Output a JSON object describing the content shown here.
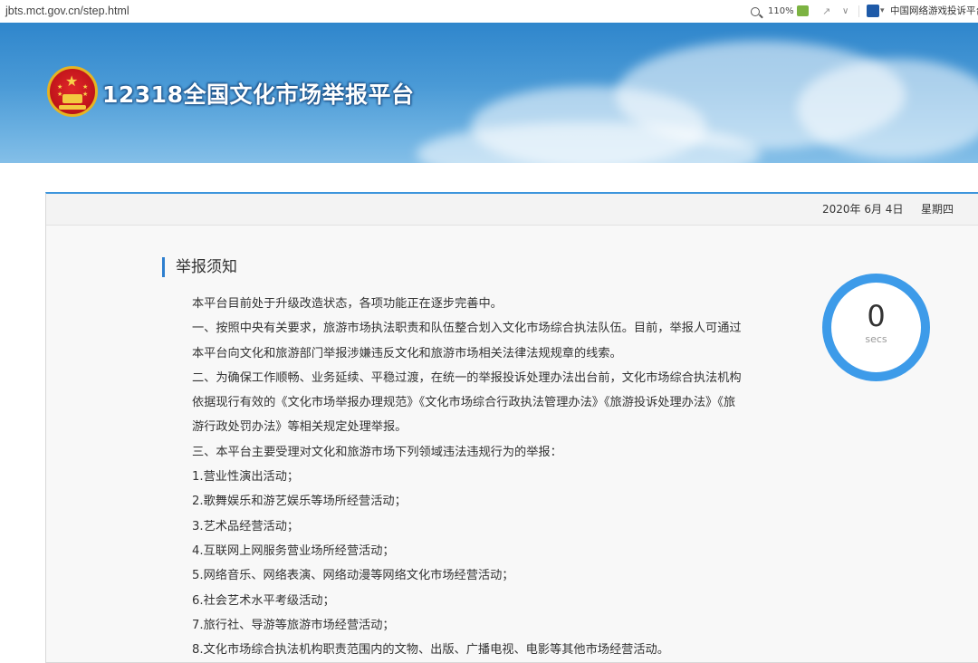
{
  "browser": {
    "url": "jbts.mct.gov.cn/step.html",
    "zoom": "110%",
    "share_glyph": "↗",
    "dropdown_glyph": "∨",
    "favorite_caret": "▾",
    "site_name": "中国网络游戏投诉平台"
  },
  "header": {
    "title": "12318全国文化市场举报平台"
  },
  "datebar": {
    "date": "2020年 6月 4日",
    "weekday": "星期四"
  },
  "notice": {
    "title": "举报须知",
    "paragraphs": [
      "本平台目前处于升级改造状态，各项功能正在逐步完善中。",
      "一、按照中央有关要求，旅游市场执法职责和队伍整合划入文化市场综合执法队伍。目前，举报人可通过本平台向文化和旅游部门举报涉嫌违反文化和旅游市场相关法律法规规章的线索。",
      "二、为确保工作顺畅、业务延续、平稳过渡，在统一的举报投诉处理办法出台前，文化市场综合执法机构依据现行有效的《文化市场举报办理规范》《文化市场综合行政执法管理办法》《旅游投诉处理办法》《旅游行政处罚办法》等相关规定处理举报。",
      "三、本平台主要受理对文化和旅游市场下列领域违法违规行为的举报："
    ],
    "items": [
      "1.营业性演出活动；",
      "2.歌舞娱乐和游艺娱乐等场所经营活动；",
      "3.艺术品经营活动；",
      "4.互联网上网服务营业场所经营活动；",
      "5.网络音乐、网络表演、网络动漫等网络文化市场经营活动；",
      "6.社会艺术水平考级活动；",
      "7.旅行社、导游等旅游市场经营活动；",
      "8.文化市场综合执法机构职责范围内的文物、出版、广播电视、电影等其他市场经营活动。"
    ]
  },
  "countdown": {
    "value": "0",
    "unit": "secs"
  },
  "icons": {
    "zoom": "magnifier-icon",
    "reader": "reader-mode-icon",
    "share": "share-icon",
    "dropdown": "chevron-down-icon",
    "favorite": "site-favicon-icon",
    "emblem": "national-emblem-icon"
  },
  "colors": {
    "banner": "#4a9ad6",
    "accent": "#3d95dc",
    "ring": "#3d9be9",
    "title_bar": "#2d7fcf"
  }
}
